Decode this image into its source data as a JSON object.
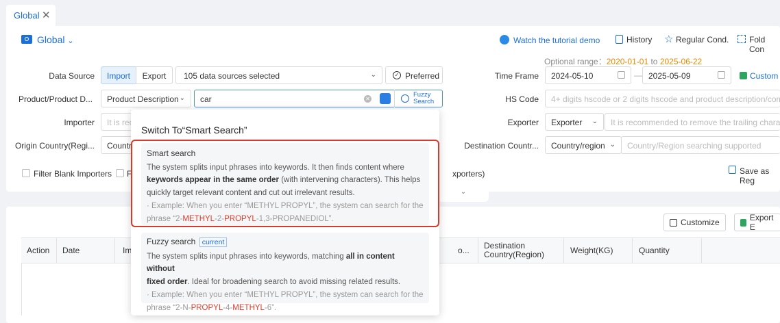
{
  "tab": {
    "label": "Global"
  },
  "header": {
    "title": "Global",
    "watch": "Watch the tutorial demo",
    "history": "History",
    "regular": "Regular Cond.",
    "fold": "Fold Con"
  },
  "range": {
    "label": "Optional range：",
    "start": "2020-01-01",
    "to": "to",
    "end": "2025-06-22"
  },
  "data_source": {
    "label": "Data Source",
    "import": "Import",
    "export": "Export",
    "selected": "105 data sources selected",
    "preferred": "Preferred"
  },
  "time_frame": {
    "label": "Time Frame",
    "start": "2024-05-10",
    "end": "2025-05-09",
    "custom": "Custom",
    "dash": "—"
  },
  "product": {
    "label": "Product/Product D...",
    "type": "Product Description",
    "value": "car",
    "fuzzy_line1": "Fuzzy",
    "fuzzy_line2": "Search"
  },
  "hs": {
    "label": "HS Code",
    "placeholder": "4+ digits hscode or 2 digits hscode and product description/compa"
  },
  "importer": {
    "label": "Importer",
    "placeholder": "It is rec"
  },
  "exporter": {
    "label": "Exporter",
    "type": "Exporter",
    "placeholder": "It is recommended to remove the trailing characte"
  },
  "origin": {
    "label": "Origin Country(Regi...",
    "value": "Country"
  },
  "destination": {
    "label": "Destination Countr...",
    "type": "Country/region",
    "placeholder": "Country/Region searching supported"
  },
  "filters": {
    "blank_importers": "Filter Blank Importers",
    "f2": "F",
    "exporters_tail": "xporters)",
    "save": "Save as Reg"
  },
  "toolbar": {
    "customize": "Customize",
    "export": "Export E"
  },
  "table": {
    "headers": [
      "Action",
      "Date",
      "Im",
      "o...",
      "Destination Country(Region)",
      "Weight(KG)",
      "Quantity"
    ]
  },
  "popup": {
    "title": "Switch To“Smart Search”",
    "smart": {
      "title": "Smart search",
      "l1": "The system splits input phrases into keywords. It then finds content where",
      "b1": "keywords appear in the same order",
      "l2": " (with intervening characters). This helps",
      "l3": "quickly target relevant content and cut out irrelevant results.",
      "e1": "· Example: When you enter “METHYL PROPYL”, the system can search for the",
      "e2a": "phrase “2-",
      "e2b": "METHYL",
      "e2c": "-2-",
      "e2d": "PROPYL",
      "e2e": "-1,3-PROPANEDIOL”."
    },
    "fuzzy": {
      "title": "Fuzzy search",
      "badge": "current",
      "l1a": "The system splits input phrases into keywords, matching ",
      "b1": "all in content without",
      "b2": "fixed order",
      "l2": ". Ideal for broadening search to avoid missing related results.",
      "e1": "· Example: When you enter “METHYL PROPYL”, the system can search for the",
      "e2a": "phrase “2-N-",
      "e2b": "PROPYL",
      "e2c": "-4-",
      "e2d": "METHYL",
      "e2e": "-6”."
    }
  }
}
